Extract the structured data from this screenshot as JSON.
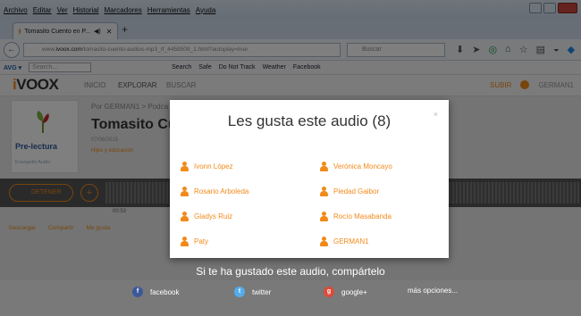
{
  "browser": {
    "menu": [
      "Archivo",
      "Editar",
      "Ver",
      "Historial",
      "Marcadores",
      "Herramientas",
      "Ayuda"
    ],
    "tab_title": "Tomasito Cuento en P...",
    "url_prefix": "www.",
    "url_domain": "ivoox.com",
    "url_rest": "/tomasito-cuento-audios-mp3_rf_4458509_1.html?autoplay=true",
    "search_placeholder": "Buscar"
  },
  "toolbar": {
    "search_placeholder": "Search...",
    "items": [
      "Search",
      "Safe",
      "Do Not Track",
      "Weather",
      "Facebook"
    ]
  },
  "site": {
    "logo_i": "i",
    "logo_rest": "VOOX",
    "nav_inicio": "INICIO",
    "nav_explorar": "EXPLORAR",
    "nav_buscar": "BUSCAR",
    "nav_subir": "SUBIR",
    "user": "GERMAN1",
    "breadcrumb": "Por GERMAN1  >  Podca",
    "title": "Tomasito Cu",
    "date": "07/06/2015",
    "category": "Hijos y educación",
    "cover_title": "Pre-lectura",
    "cover_sub": "Evangelio Audio",
    "stop_label": "DETENER",
    "time": "00:53",
    "action_download": "Descargar",
    "action_share": "Compartir",
    "action_like": "Me gusta"
  },
  "modal": {
    "title": "Les gusta este audio (8)",
    "close": "×",
    "left_column": [
      "Ivonn López",
      "Rosario Arboleda",
      "Gladys Ruiz",
      "Paty"
    ],
    "right_column": [
      "Verónica Moncayo",
      "Piedad Gaibor",
      "Rocío Masabanda",
      "GERMAN1"
    ]
  },
  "share": {
    "title": "Si te ha gustado este audio, compártelo",
    "facebook": "facebook",
    "twitter": "twitter",
    "google": "google+",
    "more": "más opciones..."
  },
  "colors": {
    "accent": "#f28a1a",
    "facebook": "#3b5998",
    "twitter": "#55acee",
    "google": "#dd4b39"
  }
}
